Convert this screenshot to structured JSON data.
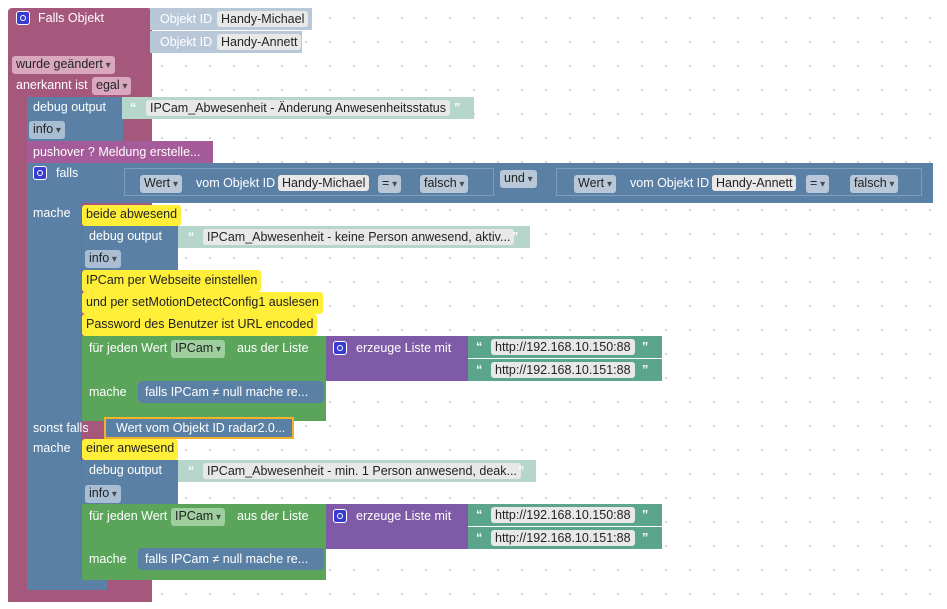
{
  "trigger": {
    "title": "Falls Objekt",
    "object_label": "Objekt ID",
    "objects": [
      "Handy-Michael",
      "Handy-Annett"
    ],
    "changed": "wurde geändert",
    "ack_label": "anerkannt ist",
    "ack_value": "egal"
  },
  "debug1": {
    "label": "debug output",
    "text": "IPCam_Abwesenheit - Änderung Anwesenheitsstatus",
    "level": "info"
  },
  "pushover": {
    "label": "pushover ? Meldung erstelle..."
  },
  "if_block": {
    "falls": "falls",
    "mache": "mache",
    "sonst_falls": "sonst falls",
    "cond1": {
      "wert": "Wert",
      "vom": "vom Objekt ID",
      "obj": "Handy-Michael",
      "op": "=",
      "val": "falsch"
    },
    "und": "und",
    "cond2": {
      "wert": "Wert",
      "vom": "vom Objekt ID",
      "obj": "Handy-Annett",
      "op": "=",
      "val": "falsch"
    },
    "elseif_cond": "Wert vom Objekt ID radar2.0..."
  },
  "branch1": {
    "comment": "beide abwesend",
    "debug_label": "debug output",
    "debug_text": "IPCam_Abwesenheit - keine Person anwesend, aktiv...",
    "level": "info",
    "notes": [
      "IPCam per Webseite einstellen",
      "und per setMotionDetectConfig1 auslesen",
      "Password des Benutzer ist URL encoded"
    ],
    "foreach": "für jeden Wert",
    "var": "IPCam",
    "from_list": "aus der Liste",
    "create_list": "erzeuge Liste mit",
    "urls": [
      "http://192.168.10.150:88",
      "http://192.168.10.151:88"
    ],
    "mache": "mache",
    "body": "falls IPCam ≠ null mache re..."
  },
  "branch2": {
    "comment": "einer anwesend",
    "debug_label": "debug output",
    "debug_text": "IPCam_Abwesenheit - min. 1 Person anwesend, deak...",
    "level": "info",
    "foreach": "für jeden Wert",
    "var": "IPCam",
    "from_list": "aus der Liste",
    "create_list": "erzeuge Liste mit",
    "urls": [
      "http://192.168.10.150:88",
      "http://192.168.10.151:88"
    ],
    "mache": "mache",
    "body": "falls IPCam ≠ null mache re..."
  },
  "quote_open": "“",
  "quote_close": "”"
}
